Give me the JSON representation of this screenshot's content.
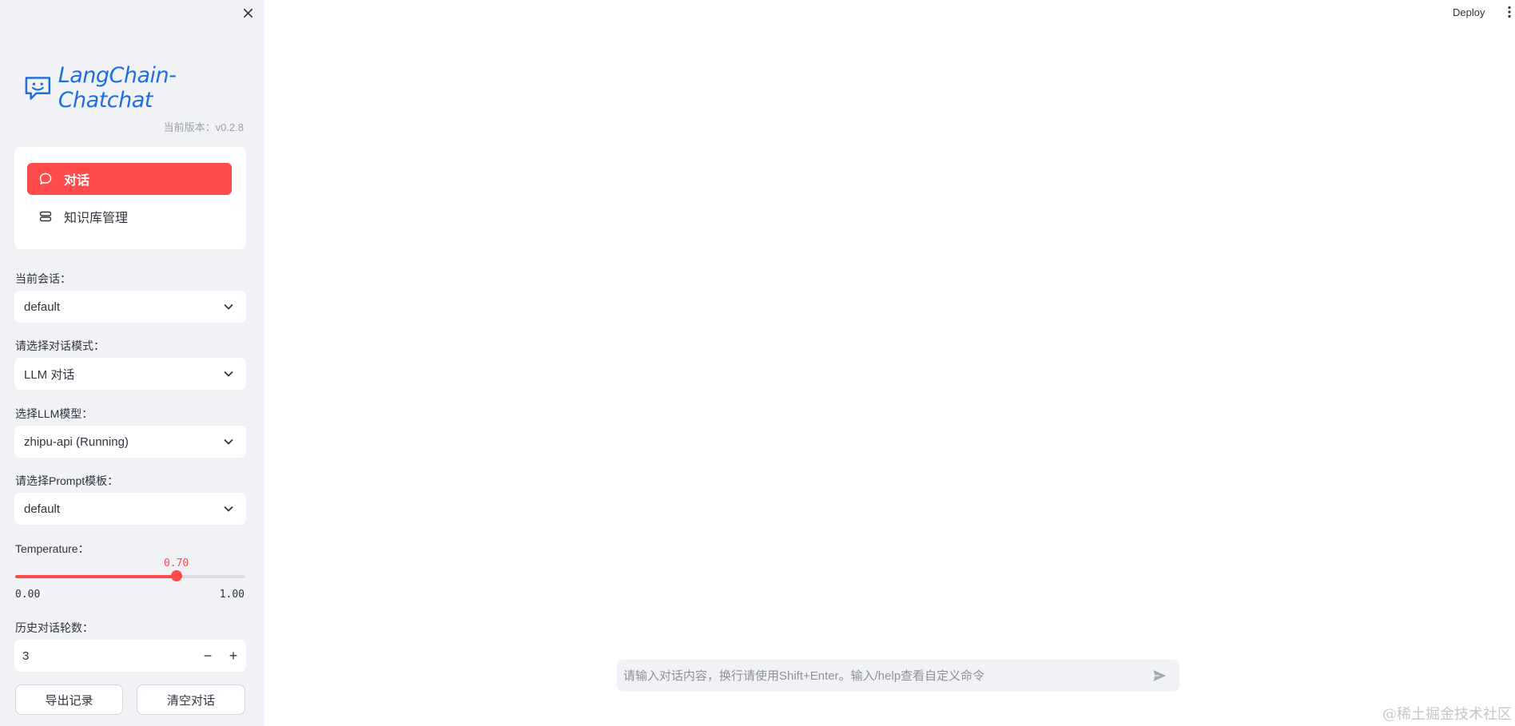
{
  "sidebar": {
    "logo_text": "LangChain-Chatchat",
    "version": "当前版本：v0.2.8",
    "nav": [
      {
        "label": "对话",
        "icon": "chat-bubble-icon",
        "active": true
      },
      {
        "label": "知识库管理",
        "icon": "database-icon",
        "active": false
      }
    ],
    "current_session": {
      "label": "当前会话：",
      "value": "default"
    },
    "dialog_mode": {
      "label": "请选择对话模式：",
      "value": "LLM 对话"
    },
    "llm_model": {
      "label": "选择LLM模型：",
      "value": "zhipu-api (Running)"
    },
    "prompt_template": {
      "label": "请选择Prompt模板：",
      "value": "default"
    },
    "temperature": {
      "label": "Temperature：",
      "value": 0.7,
      "value_text": "0.70",
      "min": "0.00",
      "max": "1.00",
      "min_value": 0,
      "max_value": 1
    },
    "history_rounds": {
      "label": "历史对话轮数：",
      "value": "3",
      "minus": "−",
      "plus": "+"
    },
    "buttons": {
      "export": "导出记录",
      "clear": "清空对话"
    }
  },
  "header": {
    "deploy": "Deploy"
  },
  "chat": {
    "placeholder": "请输入对话内容，换行请使用Shift+Enter。输入/help查看自定义命令"
  },
  "watermark": "@稀土掘金技术社区",
  "colors": {
    "accent": "#ff4b4b",
    "logo": "#1f6fe0",
    "sidebar_bg": "#f0f2f6"
  }
}
